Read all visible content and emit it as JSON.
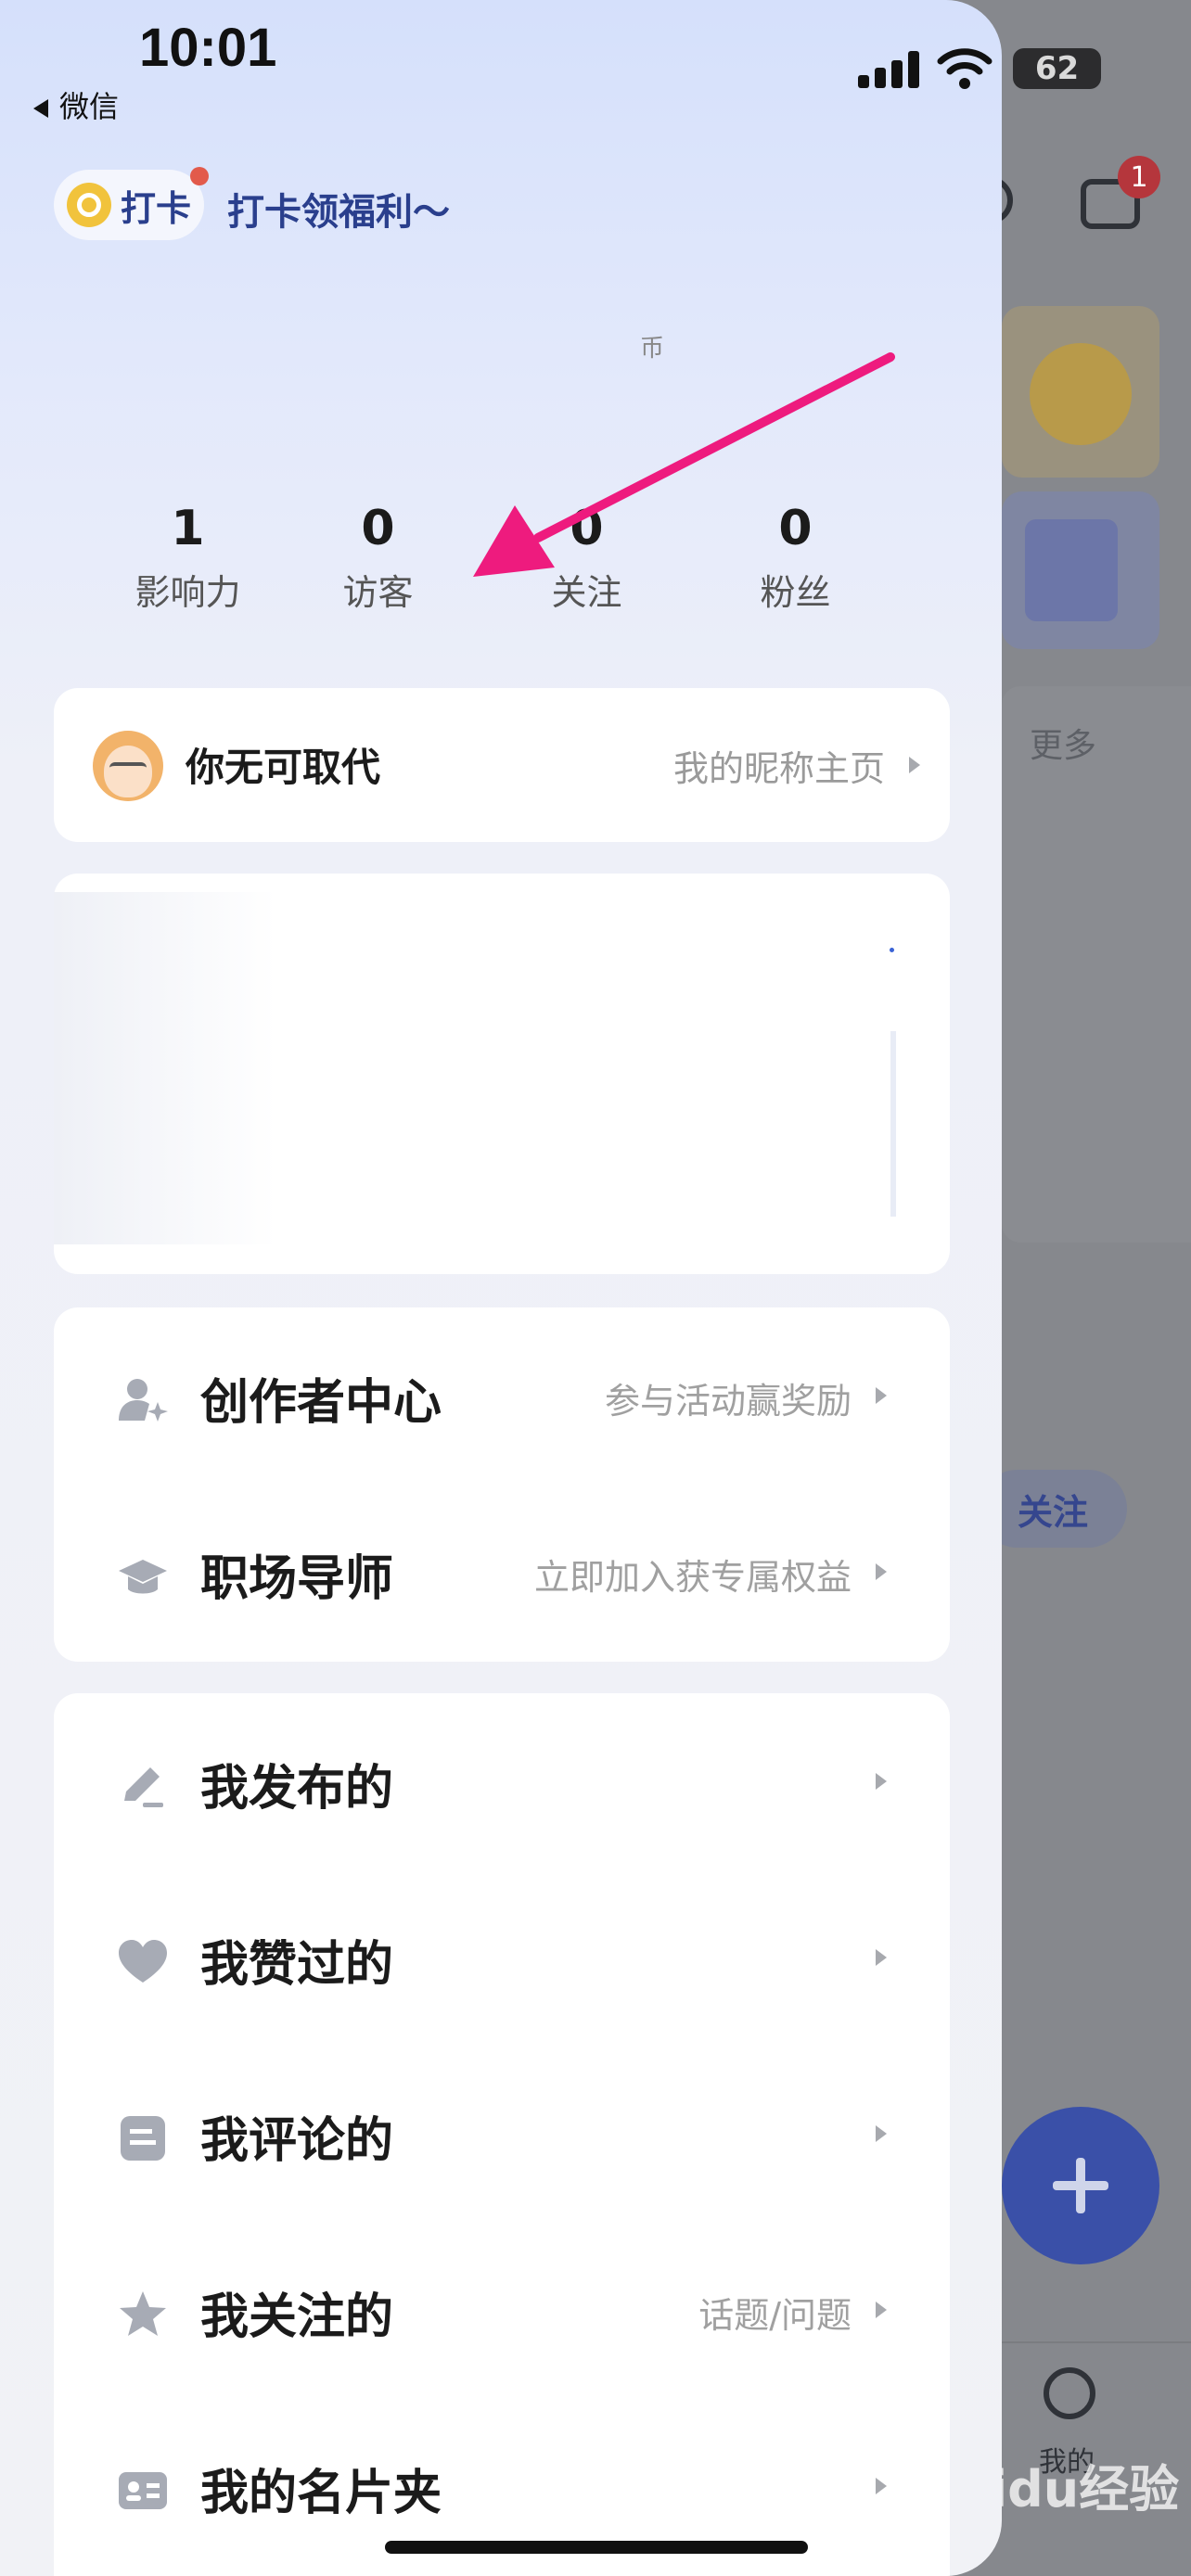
{
  "status_bar": {
    "time": "10:01",
    "back_label": "微信",
    "battery": "62"
  },
  "background": {
    "more_label": "更多",
    "follow_label": "关注",
    "tab_label": "我的",
    "chat_badge": "1",
    "watermark": "Baidu经验"
  },
  "drawer": {
    "checkin": {
      "label": "打卡",
      "promo": "打卡领福利～"
    },
    "glyph": "币",
    "stats": [
      {
        "value": "1",
        "label": "影响力"
      },
      {
        "value": "0",
        "label": "访客"
      },
      {
        "value": "0",
        "label": "关注"
      },
      {
        "value": "0",
        "label": "粉丝"
      }
    ],
    "profile": {
      "name": "你无可取代",
      "link": "我的昵称主页"
    },
    "menu_group1": [
      {
        "icon": "person-star-icon",
        "label": "创作者中心",
        "hint": "参与活动赢奖励"
      },
      {
        "icon": "graduation-cap-icon",
        "label": "职场导师",
        "hint": "立即加入获专属权益"
      }
    ],
    "menu_group2": [
      {
        "icon": "pencil-icon",
        "label": "我发布的",
        "hint": ""
      },
      {
        "icon": "heart-icon",
        "label": "我赞过的",
        "hint": ""
      },
      {
        "icon": "comment-icon",
        "label": "我评论的",
        "hint": ""
      },
      {
        "icon": "star-icon",
        "label": "我关注的",
        "hint": "话题/问题"
      },
      {
        "icon": "id-card-icon",
        "label": "我的名片夹",
        "hint": ""
      }
    ]
  },
  "colors": {
    "accent": "#2a3f8d",
    "annotation_arrow": "#ee1b7e",
    "fab": "#3a50a8"
  }
}
